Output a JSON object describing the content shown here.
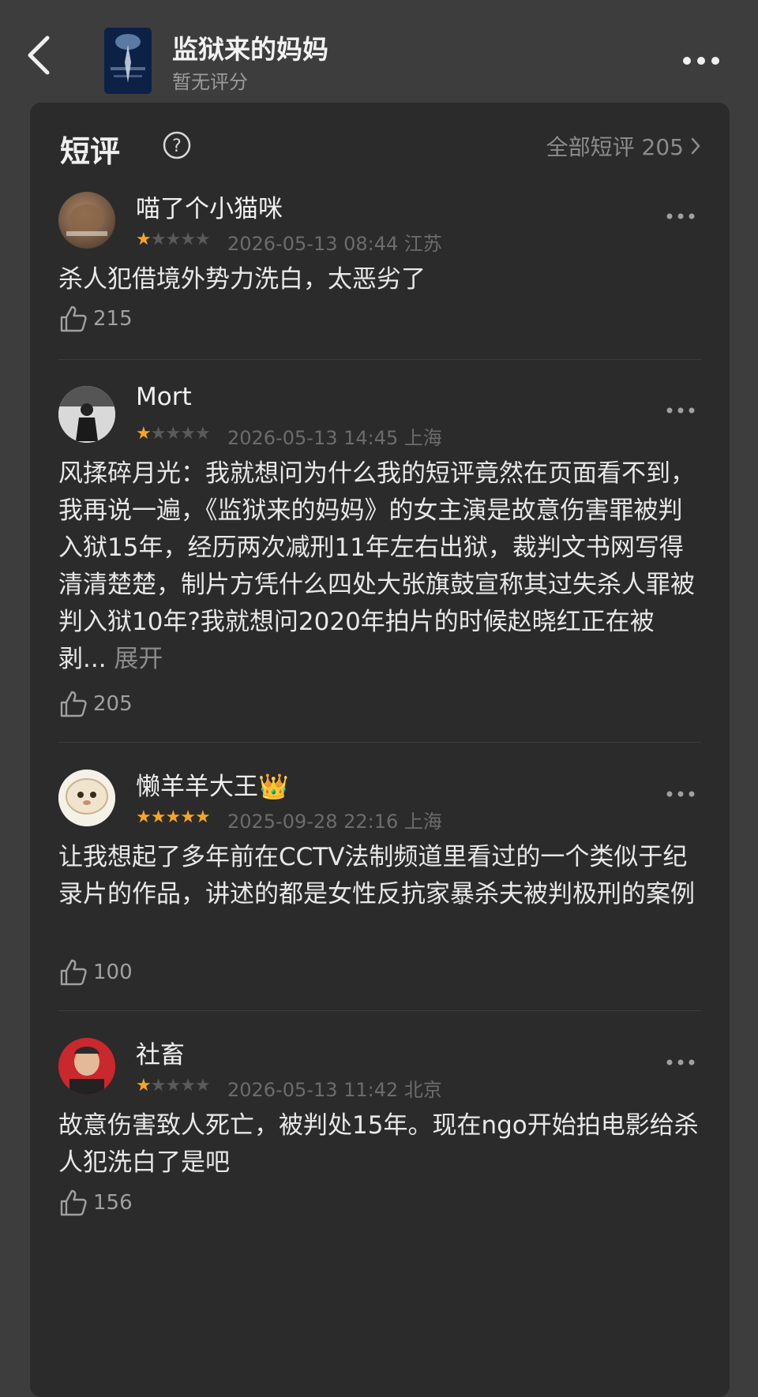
{
  "header": {
    "title": "监狱来的妈妈",
    "subtitle": "暂无评分"
  },
  "section": {
    "title": "短评",
    "all_label": "全部短评 205"
  },
  "reviews": [
    {
      "username": "喵了个小猫咪",
      "rating": 1,
      "date": "2026-05-13 08:44",
      "location": "江苏",
      "text": "杀人犯借境外势力洗白，太恶劣了",
      "likes": "215"
    },
    {
      "username": "Mort",
      "rating": 1,
      "date": "2026-05-13 14:45",
      "location": "上海",
      "text": "风揉碎月光：我就想问为什么我的短评竟然在页面看不到，我再说一遍，《监狱来的妈妈》的女主演是故意伤害罪被判入狱15年，经历两次减刑11年左右出狱，裁判文书网写得清清楚楚，制片方凭什么四处大张旗鼓宣称其过失杀人罪被判入狱10年?我就想问2020年拍片的时候赵晓红正在被剥...",
      "expand_label": "展开",
      "likes": "205"
    },
    {
      "username": "懒羊羊大王",
      "badge": "👑",
      "rating": 5,
      "date": "2025-09-28 22:16",
      "location": "上海",
      "text": "让我想起了多年前在CCTV法制频道里看过的一个类似于纪录片的作品，讲述的都是女性反抗家暴杀夫被判极刑的案例",
      "likes": "100"
    },
    {
      "username": "社畜",
      "rating": 1,
      "date": "2026-05-13 11:42",
      "location": "北京",
      "text": "故意伤害致人死亡，被判处15年。现在ngo开始拍电影给杀人犯洗白了是吧",
      "likes": "156"
    }
  ],
  "colors": {
    "background": "#3d3d3d",
    "panel": "#2b2b2b",
    "star_active": "#f5a623",
    "star_inactive": "#5a5a5a"
  },
  "icons": {
    "back": "back-arrow-icon",
    "more": "more-dots-icon",
    "help": "question-circle-icon",
    "chevron": "chevron-right-icon",
    "like": "thumbs-up-icon"
  }
}
